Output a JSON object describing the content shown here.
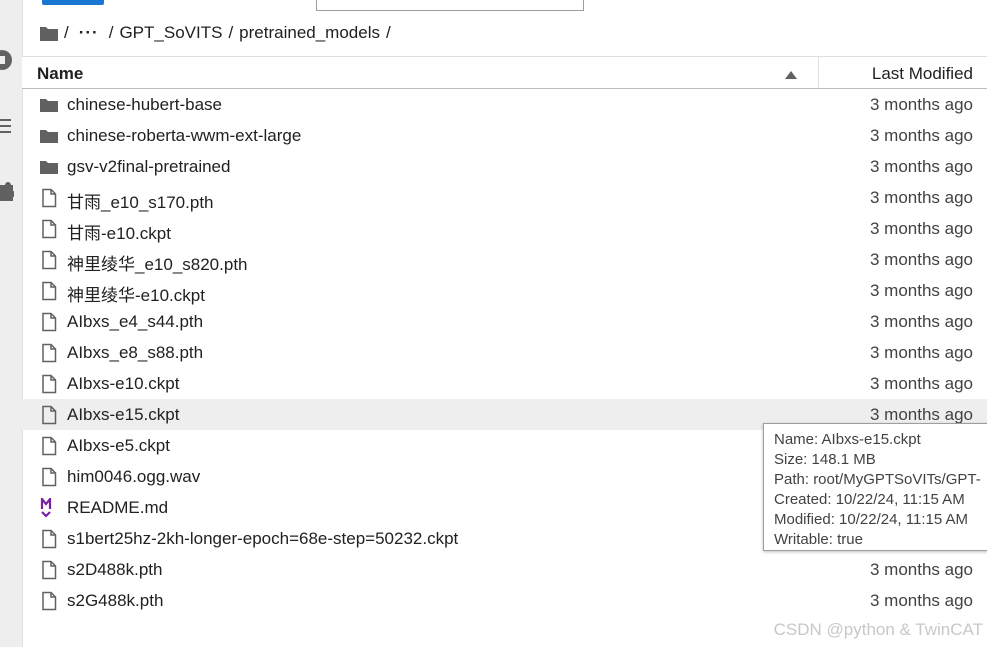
{
  "breadcrumb": {
    "sep": "/",
    "ellipsis": "···",
    "segments": [
      "GPT_SoVITS",
      "pretrained_models"
    ]
  },
  "table": {
    "header_name": "Name",
    "header_modified": "Last Modified"
  },
  "files": [
    {
      "name": "chinese-hubert-base",
      "modified": "3 months ago",
      "icon": "folder-icon"
    },
    {
      "name": "chinese-roberta-wwm-ext-large",
      "modified": "3 months ago",
      "icon": "folder-icon"
    },
    {
      "name": "gsv-v2final-pretrained",
      "modified": "3 months ago",
      "icon": "folder-icon"
    },
    {
      "name": "甘雨_e10_s170.pth",
      "modified": "3 months ago",
      "icon": "file-icon"
    },
    {
      "name": "甘雨-e10.ckpt",
      "modified": "3 months ago",
      "icon": "file-icon"
    },
    {
      "name": "神里绫华_e10_s820.pth",
      "modified": "3 months ago",
      "icon": "file-icon"
    },
    {
      "name": "神里绫华-e10.ckpt",
      "modified": "3 months ago",
      "icon": "file-icon"
    },
    {
      "name": "AIbxs_e4_s44.pth",
      "modified": "3 months ago",
      "icon": "file-icon"
    },
    {
      "name": "AIbxs_e8_s88.pth",
      "modified": "3 months ago",
      "icon": "file-icon"
    },
    {
      "name": "AIbxs-e10.ckpt",
      "modified": "3 months ago",
      "icon": "file-icon"
    },
    {
      "name": "AIbxs-e15.ckpt",
      "modified": "3 months ago",
      "icon": "file-icon"
    },
    {
      "name": "AIbxs-e5.ckpt",
      "modified": "",
      "icon": "file-icon"
    },
    {
      "name": "him0046.ogg.wav",
      "modified": "",
      "icon": "file-icon"
    },
    {
      "name": "README.md",
      "modified": "",
      "icon": "markdown-icon"
    },
    {
      "name": "s1bert25hz-2kh-longer-epoch=68e-step=50232.ckpt",
      "modified": "",
      "icon": "file-icon"
    },
    {
      "name": "s2D488k.pth",
      "modified": "3 months ago",
      "icon": "file-icon"
    },
    {
      "name": "s2G488k.pth",
      "modified": "3 months ago",
      "icon": "file-icon"
    }
  ],
  "tooltip": {
    "name": "Name: AIbxs-e15.ckpt",
    "size": "Size: 148.1 MB",
    "path": "Path: root/MyGPTSoVITs/GPT-",
    "created": "Created: 10/22/24, 11:15 AM",
    "modified": "Modified: 10/22/24, 11:15 AM",
    "writable": "Writable: true"
  },
  "watermark": "CSDN @python & TwinCAT",
  "colors": {
    "accent": "#1976d2",
    "markdown": "#7b1fa2",
    "hover_row": "#eeeeee"
  }
}
